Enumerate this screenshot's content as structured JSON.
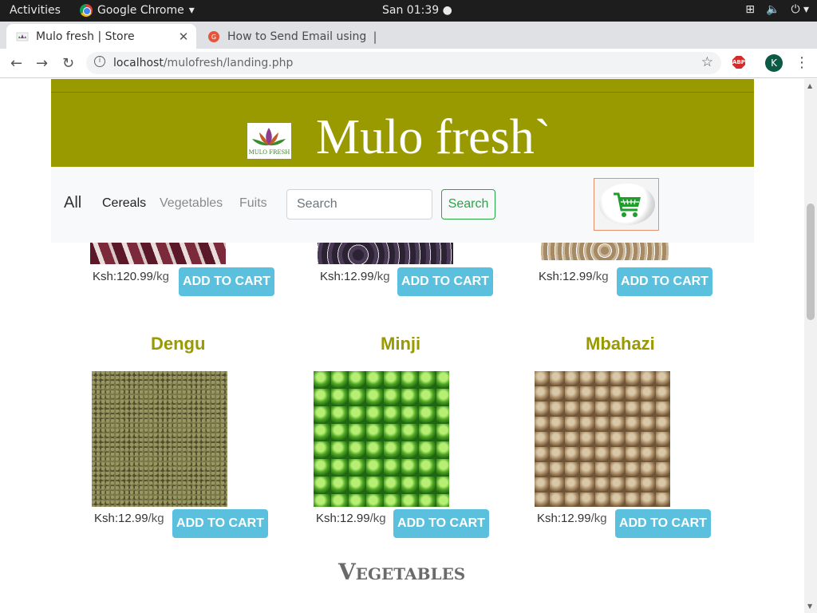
{
  "os_bar": {
    "activities": "Activities",
    "app_name": "Google Chrome",
    "clock": "San 01:39"
  },
  "browser": {
    "tabs": [
      {
        "title": "Mulo fresh | Store"
      },
      {
        "title": "How to Send Email using"
      }
    ],
    "url_host": "localhost",
    "url_path": "/mulofresh/landing.php",
    "profile_initial": "K"
  },
  "site": {
    "brand": "Mulo fresh`",
    "logo_text": "MULO FRESH",
    "nav": {
      "all": "All",
      "cereals": "Cereals",
      "vegetables": "Vegetables",
      "fruits": "Fuits"
    },
    "search": {
      "placeholder": "Search",
      "button": "Search"
    },
    "colors": {
      "brand": "#999900",
      "cart_button": "#5bc0de",
      "search_button": "#28a745"
    }
  },
  "products_partial": [
    {
      "price": "Ksh:120.99",
      "unit": "/kg",
      "cta": "ADD TO CART"
    },
    {
      "price": "Ksh:12.99",
      "unit": "/kg",
      "cta": "ADD TO CART"
    },
    {
      "price": "Ksh:12.99",
      "unit": "/kg",
      "cta": "ADD TO CART"
    }
  ],
  "products": [
    {
      "name": "Dengu",
      "price": "Ksh:12.99",
      "unit": "/kg",
      "cta": "ADD TO CART"
    },
    {
      "name": "Minji",
      "price": "Ksh:12.99",
      "unit": "/kg",
      "cta": "ADD TO CART"
    },
    {
      "name": "Mbahazi",
      "price": "Ksh:12.99",
      "unit": "/kg",
      "cta": "ADD TO CART"
    }
  ],
  "next_section": "Vegetables"
}
